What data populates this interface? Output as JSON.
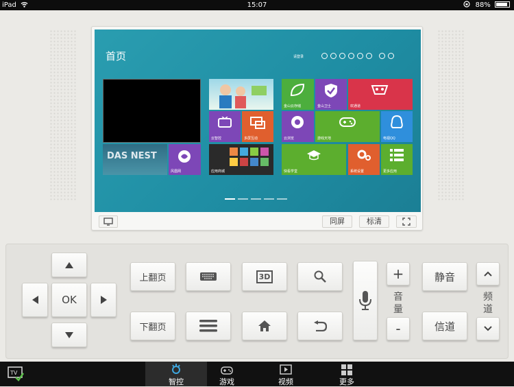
{
  "status_bar": {
    "device": "iPad",
    "time": "15:07",
    "battery": "88%"
  },
  "tv_screen": {
    "title": "首页",
    "login": "请登录",
    "tiles": [
      {
        "label": "风凰网"
      },
      {
        "label": "云智控"
      },
      {
        "label": "多屏互动"
      },
      {
        "label": "应用商城"
      },
      {
        "label": "金山云存储"
      },
      {
        "label": "金山卫士"
      },
      {
        "label": "欢通道"
      },
      {
        "label": "云浏览"
      },
      {
        "label": "游戏天地"
      },
      {
        "label": "电视QQ"
      },
      {
        "label": "快看学堂"
      },
      {
        "label": "系统设置"
      },
      {
        "label": "更多应用"
      }
    ],
    "banner_text": "DAS NEST"
  },
  "screen_controls": {
    "mirror_label": "同屏",
    "quality_label": "标清"
  },
  "remote": {
    "ok_label": "OK",
    "page_up_label": "上翻页",
    "page_down_label": "下翻页",
    "mute_label": "静音",
    "source_label": "信道",
    "volume_label_1": "音",
    "volume_label_2": "量",
    "channel_label_1": "频",
    "channel_label_2": "道",
    "plus_label": "+",
    "minus_label": "-",
    "key_3d_label": "3D"
  },
  "tabs": [
    {
      "label": "智控",
      "icon": "control-icon",
      "active": true
    },
    {
      "label": "游戏",
      "icon": "gamepad-icon",
      "active": false
    },
    {
      "label": "视频",
      "icon": "video-icon",
      "active": false
    },
    {
      "label": "更多",
      "icon": "grid-icon",
      "active": false
    }
  ],
  "colors": {
    "accent": "#2a9db0",
    "tab_active_icon": "#3ea8e0"
  }
}
